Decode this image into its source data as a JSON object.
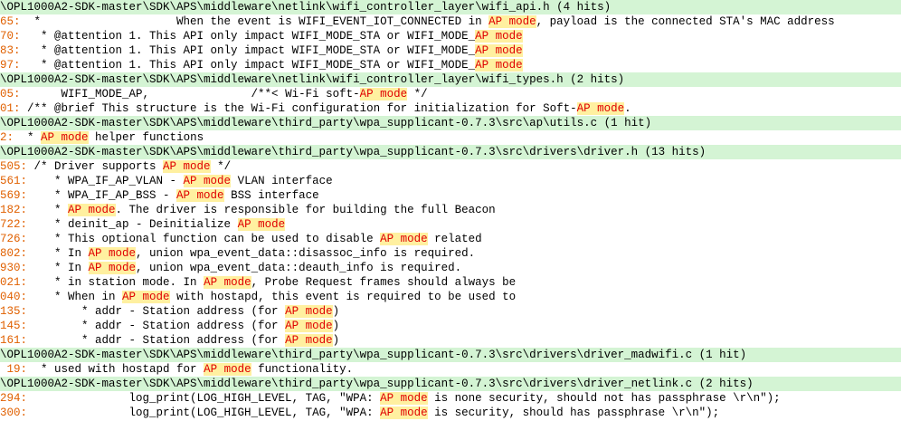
{
  "search": {
    "highlight_color": "#fff0a0",
    "highlight_text_color": "#e00000",
    "file_header_bg": "#d4f4d4",
    "line_number_color": "#e06000",
    "rows": [
      {
        "type": "line",
        "num": "65:",
        "code": "  *                    When the event is WIFI_EVENT_IOT_CONNECTED in ",
        "match": "AP mode",
        "rest": ", payload is the connected STA's MAC address"
      },
      {
        "type": "line",
        "num": "70:",
        "code": "   * @attention 1. This API only impact WIFI_MODE_STA or WIFI_MODE_",
        "match": "AP mode",
        "rest": ""
      },
      {
        "type": "line",
        "num": "83:",
        "code": "   * @attention 1. This API only impact WIFI_MODE_STA or WIFI_MODE_",
        "match": "AP mode",
        "rest": ""
      },
      {
        "type": "line",
        "num": "97:",
        "code": "   * @attention 1. This API only impact WIFI_MODE_STA or WIFI_MODE_",
        "match": "AP mode",
        "rest": ""
      },
      {
        "type": "file",
        "text": "\\OPL1000A2-SDK-master\\SDK\\APS\\middleware\\netlink\\wifi_controller_layer\\wifi_types.h (2 hits)"
      },
      {
        "type": "line",
        "num": "05:",
        "code": "      WIFI_MODE_AP,               /**< Wi-Fi soft-",
        "match": "AP mode",
        "rest": " */"
      },
      {
        "type": "line",
        "num": "01:",
        "code": " /** @brief This structure is the Wi-Fi configuration for initialization for Soft-",
        "match": "AP mode",
        "rest": "."
      },
      {
        "type": "file",
        "text": "\\OPL1000A2-SDK-master\\SDK\\APS\\middleware\\third_party\\wpa_supplicant-0.7.3\\src\\ap\\utils.c (1 hit)"
      },
      {
        "type": "line",
        "num": "2:",
        "code": "  * ",
        "match": "AP mode",
        "rest": " helper functions"
      },
      {
        "type": "file",
        "text": "\\OPL1000A2-SDK-master\\SDK\\APS\\middleware\\third_party\\wpa_supplicant-0.7.3\\src\\drivers\\driver.h (13 hits)"
      },
      {
        "type": "line",
        "num": "505:",
        "code": " /* Driver supports ",
        "match": "AP mode",
        "rest": " */"
      },
      {
        "type": "line",
        "num": "561:",
        "code": "    * WPA_IF_AP_VLAN - ",
        "match": "AP mode",
        "rest": " VLAN interface"
      },
      {
        "type": "line",
        "num": "569:",
        "code": "    * WPA_IF_AP_BSS - ",
        "match": "AP mode",
        "rest": " BSS interface"
      },
      {
        "type": "line",
        "num": "182:",
        "code": "    * ",
        "match": "AP mode",
        "rest": ". The driver is responsible for building the full Beacon"
      },
      {
        "type": "line",
        "num": "722:",
        "code": "    * deinit_ap - Deinitialize ",
        "match": "AP mode",
        "rest": ""
      },
      {
        "type": "line",
        "num": "726:",
        "code": "    * This optional function can be used to disable ",
        "match": "AP mode",
        "rest": " related"
      },
      {
        "type": "line",
        "num": "802:",
        "code": "    * In ",
        "match": "AP mode",
        "rest": ", union wpa_event_data::disassoc_info is required."
      },
      {
        "type": "line",
        "num": "930:",
        "code": "    * In ",
        "match": "AP mode",
        "rest": ", union wpa_event_data::deauth_info is required."
      },
      {
        "type": "line",
        "num": "021:",
        "code": "    * in station mode. In ",
        "match": "AP mode",
        "rest": ", Probe Request frames should always be"
      },
      {
        "type": "line",
        "num": "040:",
        "code": "    * When in ",
        "match": "AP mode",
        "rest": " with hostapd, this event is required to be used to"
      },
      {
        "type": "line",
        "num": "135:",
        "code": "        * addr - Station address (for ",
        "match": "AP mode",
        "rest": ")"
      },
      {
        "type": "line",
        "num": "145:",
        "code": "        * addr - Station address (for ",
        "match": "AP mode",
        "rest": ")"
      },
      {
        "type": "line",
        "num": "161:",
        "code": "        * addr - Station address (for ",
        "match": "AP mode",
        "rest": ")"
      },
      {
        "type": "file",
        "text": "\\OPL1000A2-SDK-master\\SDK\\APS\\middleware\\third_party\\wpa_supplicant-0.7.3\\src\\drivers\\driver_madwifi.c (1 hit)"
      },
      {
        "type": "line",
        "num": " 19:",
        "code": "  * used with hostapd for ",
        "match": "AP mode",
        "rest": " functionality."
      },
      {
        "type": "file",
        "text": "\\OPL1000A2-SDK-master\\SDK\\APS\\middleware\\third_party\\wpa_supplicant-0.7.3\\src\\drivers\\driver_netlink.c (2 hits)"
      },
      {
        "type": "line",
        "num": "294:",
        "code": "               log_print(LOG_HIGH_LEVEL, TAG, \"WPA: ",
        "match": "AP mode",
        "rest": " is none security, should not has passphrase \\r\\n\");"
      },
      {
        "type": "line",
        "num": "300:",
        "code": "               log_print(LOG_HIGH_LEVEL, TAG, \"WPA: ",
        "match": "AP mode",
        "rest": " is security, should has passphrase \\r\\n\");"
      }
    ],
    "top_file": "\\OPL1000A2-SDK-master\\SDK\\APS\\middleware\\netlink\\wifi_controller_layer\\wifi_api.h (4 hits)"
  }
}
